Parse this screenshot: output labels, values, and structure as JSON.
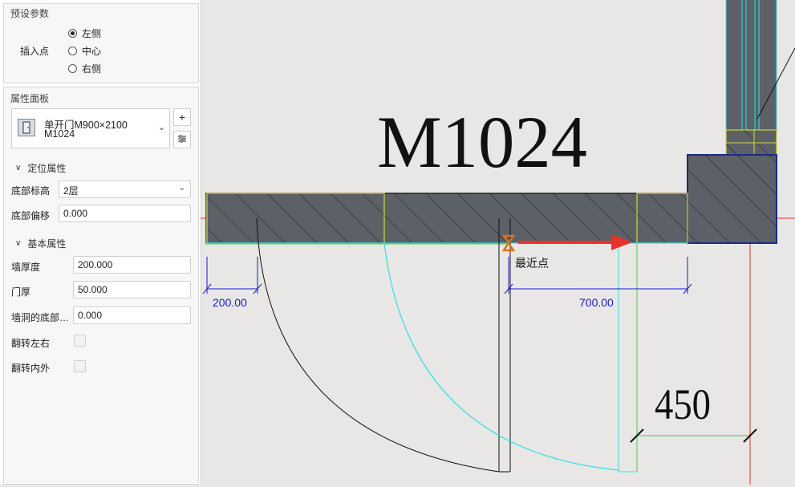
{
  "preset": {
    "title": "预设参数",
    "insert_label": "插入点",
    "options": [
      {
        "label": "左侧",
        "checked": true
      },
      {
        "label": "中心",
        "checked": false
      },
      {
        "label": "右侧",
        "checked": false
      }
    ]
  },
  "properties": {
    "title": "属性面板",
    "component": {
      "line1": "单开门M900×2100",
      "line2": "M1024"
    },
    "sections": {
      "position": "定位属性",
      "basic": "基本属性"
    },
    "fields": {
      "base_level_label": "底部标高",
      "base_level_value": "2层",
      "base_offset_label": "底部偏移",
      "base_offset_value": "0.000",
      "wall_thickness_label": "墙厚度",
      "wall_thickness_value": "200.000",
      "door_thickness_label": "门厚",
      "door_thickness_value": "50.000",
      "opening_base_label": "墙洞的底部…",
      "opening_base_value": "0.000",
      "flip_lr_label": "翻转左右",
      "flip_io_label": "翻转内外"
    }
  },
  "canvas": {
    "door_tag": "M1024",
    "dim_left": "200.00",
    "dim_right": "700.00",
    "snap_label": "最近点",
    "dim_450": "450",
    "colors": {
      "wall": "#5b6167",
      "highlight": "#d8d23a",
      "axis": "#e03030",
      "dimension": "#1a1ad0",
      "swing_cyan": "#2ee0e8",
      "snap_arrow": "#e8322a",
      "snap_marker": "#e07020",
      "green_dim": "#40d040"
    }
  }
}
